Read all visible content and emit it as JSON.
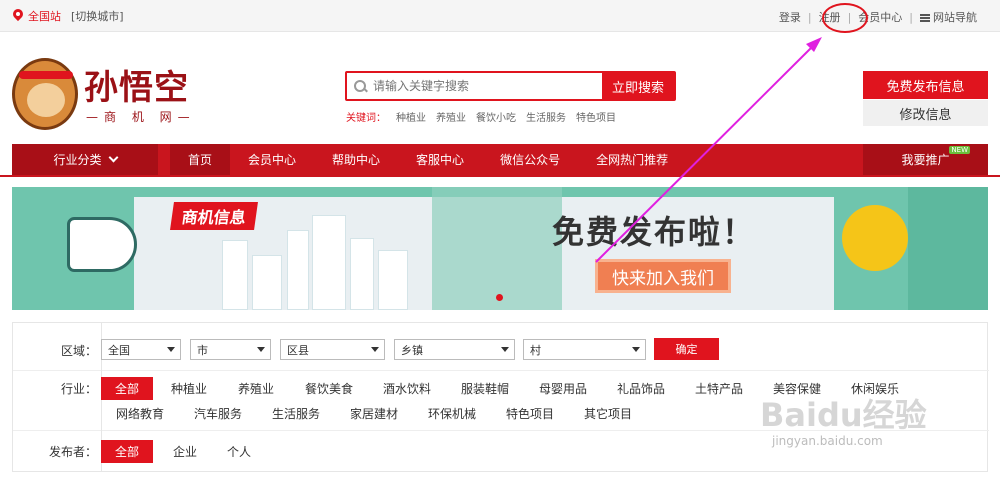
{
  "topbar": {
    "city": "全国站",
    "switch": "[切换城市]",
    "login": "登录",
    "register": "注册",
    "member": "会员中心",
    "sitenav": "网站导航"
  },
  "logo": {
    "name": "孙悟空",
    "sub": "—商 机 网—"
  },
  "search": {
    "placeholder": "请输入关键字搜索",
    "button": "立即搜索"
  },
  "keywords": {
    "label": "关键词：",
    "items": [
      "种植业",
      "养殖业",
      "餐饮小吃",
      "生活服务",
      "特色项目"
    ]
  },
  "right_buttons": {
    "publish": "免费发布信息",
    "edit": "修改信息"
  },
  "nav": {
    "category": "行业分类",
    "items": [
      "首页",
      "会员中心",
      "帮助中心",
      "客服中心",
      "微信公众号",
      "全网热门推荐"
    ],
    "promo": "我要推广",
    "new_badge": "NEW"
  },
  "banner": {
    "title": "商机信息",
    "headline": "免费发布啦！",
    "join": "快来加入我们"
  },
  "filter": {
    "region_label": "区域：",
    "selects": [
      "全国",
      "市",
      "区县",
      "乡镇",
      "村"
    ],
    "confirm": "确定",
    "industry_label": "行业：",
    "industries_row1": [
      "全部",
      "种植业",
      "养殖业",
      "餐饮美食",
      "酒水饮料",
      "服装鞋帽",
      "母婴用品",
      "礼品饰品",
      "土特产品",
      "美容保健",
      "休闲娱乐"
    ],
    "industries_row2": [
      "网络教育",
      "汽车服务",
      "生活服务",
      "家居建材",
      "环保机械",
      "特色项目",
      "其它项目"
    ],
    "publisher_label": "发布者：",
    "publishers": [
      "全部",
      "企业",
      "个人"
    ]
  },
  "watermark": {
    "text": "Baidu经验",
    "url": "jingyan.baidu.com"
  },
  "colors": {
    "brand_red": "#e0141e",
    "nav_red": "#c9151e",
    "nav_dark": "#a80f17",
    "annotation": "#e020e0"
  }
}
